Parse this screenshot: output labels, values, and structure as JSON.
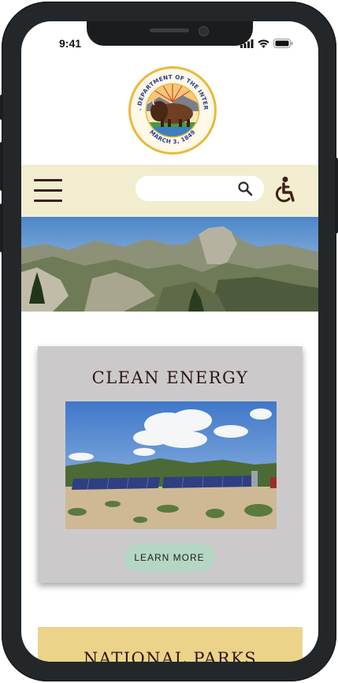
{
  "status_bar": {
    "time": "9:41"
  },
  "seal": {
    "top_text": "U.S. DEPARTMENT OF THE INTERIOR",
    "bottom_text": "MARCH 3, 1849"
  },
  "header": {
    "search": {
      "placeholder": ""
    }
  },
  "sections": [
    {
      "title": "CLEAN ENERGY",
      "button_label": "LEARN  MORE"
    },
    {
      "title": "NATIONAL PARKS"
    }
  ],
  "colors": {
    "nav_bg": "#f3edcf",
    "card_bg": "#ccc9cb",
    "button_bg": "#b6d6c5",
    "card2_bg": "#ebd38a",
    "title_text": "#2d1814"
  }
}
